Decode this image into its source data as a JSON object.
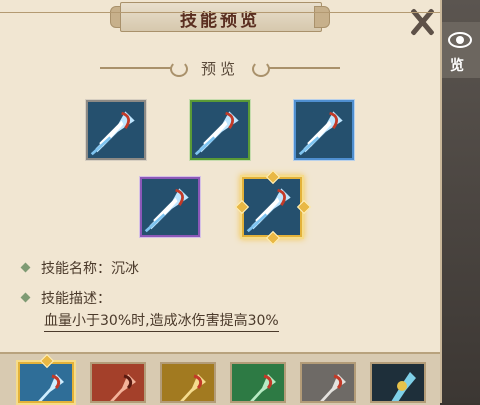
{
  "window": {
    "title": "技能预览",
    "close_icon": "close-icon"
  },
  "side": {
    "eye_label": "览"
  },
  "section": {
    "title": "预览"
  },
  "skills": [
    {
      "frame": "gray",
      "color": "#2a6fa0"
    },
    {
      "frame": "green",
      "color": "#2a6fa0"
    },
    {
      "frame": "blue",
      "color": "#2a6fa0"
    },
    {
      "frame": "purple",
      "color": "#2a6fa0"
    },
    {
      "frame": "gold",
      "color": "#2a6fa0",
      "selected": true
    }
  ],
  "info": {
    "name_label": "技能名称：",
    "name_value": "沉冰",
    "desc_label": "技能描述：",
    "desc_value": "血量小于30%时,造成冰伤害提高30%"
  },
  "bottom_slots": [
    {
      "theme": "ice",
      "selected": true,
      "color": "#3b86b8"
    },
    {
      "theme": "fire",
      "color": "#c0553a"
    },
    {
      "theme": "gold",
      "color": "#c89a2a"
    },
    {
      "theme": "poison",
      "color": "#3a9a54"
    },
    {
      "theme": "steel",
      "color": "#8a8a8a"
    },
    {
      "theme": "dark",
      "color": "#2f5a70"
    }
  ]
}
